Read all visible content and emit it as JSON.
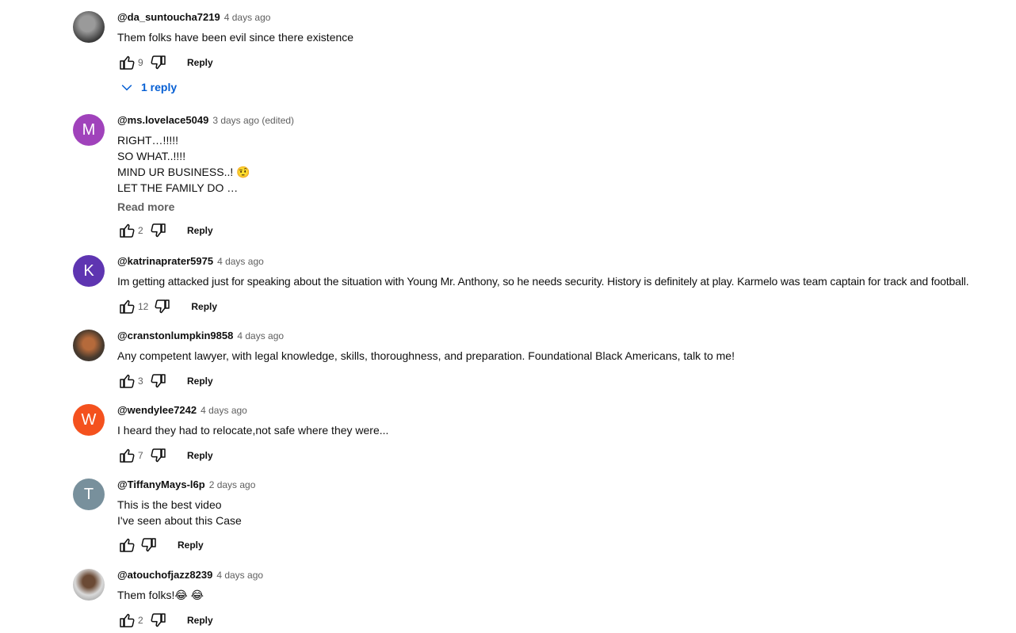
{
  "comments": [
    {
      "author": "@da_suntoucha7219",
      "time": "4 days ago",
      "lines": [
        "Them folks have been evil since there existence"
      ],
      "likes": "9",
      "reply_label": "Reply",
      "replies_toggle": "1 reply",
      "avatar_letter": "",
      "avatar_color": "#5a5a5a"
    },
    {
      "author": "@ms.lovelace5049",
      "time": "3 days ago (edited)",
      "lines": [
        "RIGHT…!!!!!",
        "SO WHAT..!!!!",
        "MIND UR BUSINESS..! 🤨",
        "LET THE FAMILY DO …"
      ],
      "read_more": "Read more",
      "likes": "2",
      "reply_label": "Reply",
      "avatar_letter": "M",
      "avatar_color": "#a042bb"
    },
    {
      "author": "@katrinaprater5975",
      "time": "4 days ago",
      "lines": [
        "Im getting attacked just for speaking about the situation with Young Mr. Anthony, so he needs security.  History is definitely at play.  Karmelo was team captain for track and football."
      ],
      "likes": "12",
      "reply_label": "Reply",
      "avatar_letter": "K",
      "avatar_color": "#5e35b1"
    },
    {
      "author": "@cranstonlumpkin9858",
      "time": "4 days ago",
      "lines": [
        "Any competent lawyer, with legal knowledge, skills, thoroughness, and preparation. Foundational Black Americans, talk to me!"
      ],
      "likes": "3",
      "reply_label": "Reply",
      "avatar_letter": "",
      "avatar_color": "#4a3b2e"
    },
    {
      "author": "@wendylee7242",
      "time": "4 days ago",
      "lines": [
        "I heard they had to relocate,not safe where they were..."
      ],
      "likes": "7",
      "reply_label": "Reply",
      "avatar_letter": "W",
      "avatar_color": "#f4511e"
    },
    {
      "author": "@TiffanyMays-l6p",
      "time": "2 days ago",
      "lines": [
        "This is the best video",
        "I've seen about this Case"
      ],
      "likes": "",
      "reply_label": "Reply",
      "avatar_letter": "T",
      "avatar_color": "#78909c"
    },
    {
      "author": "@atouchofjazz8239",
      "time": "4 days ago",
      "lines": [
        "Them folks!😂 😂"
      ],
      "likes": "2",
      "reply_label": "Reply",
      "avatar_letter": "",
      "avatar_color": "#c9c9c9"
    }
  ],
  "icons": {
    "like": "thumbs-up-icon",
    "dislike": "thumbs-down-icon",
    "expand": "chevron-down-icon"
  },
  "colors": {
    "link_blue": "#065fd4",
    "secondary_text": "#606060",
    "primary_text": "#0f0f0f"
  }
}
